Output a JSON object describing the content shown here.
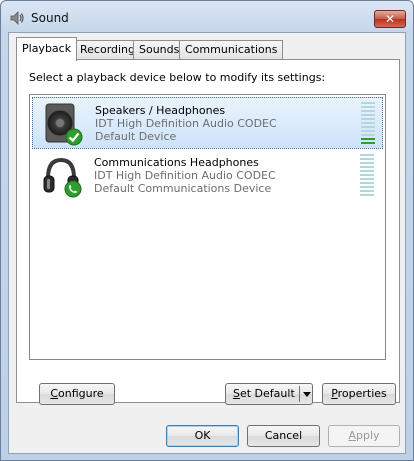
{
  "window": {
    "title": "Sound",
    "close_label": "✕"
  },
  "tabs": [
    {
      "label": "Playback"
    },
    {
      "label": "Recording"
    },
    {
      "label": "Sounds"
    },
    {
      "label": "Communications"
    }
  ],
  "instruction": "Select a playback device below to modify its settings:",
  "devices": [
    {
      "name": "Speakers / Headphones",
      "driver": "IDT High Definition Audio CODEC",
      "status": "Default Device",
      "icon": "speaker-icon",
      "badge": "default-check-icon",
      "meter_level": 0.1
    },
    {
      "name": "Communications Headphones",
      "driver": "IDT High Definition Audio CODEC",
      "status": "Default Communications Device",
      "icon": "headphones-icon",
      "badge": "communications-phone-icon",
      "meter_level": 0
    }
  ],
  "buttons": {
    "configure": {
      "prefix": "",
      "mnemonic": "C",
      "suffix": "onfigure"
    },
    "set_default": {
      "prefix": "",
      "mnemonic": "S",
      "suffix": "et Default"
    },
    "properties": {
      "prefix": "",
      "mnemonic": "P",
      "suffix": "roperties"
    },
    "ok": "OK",
    "cancel": "Cancel",
    "apply": {
      "prefix": "",
      "mnemonic": "A",
      "suffix": "pply"
    }
  },
  "colors": {
    "selection": "#cde3fa",
    "meter_lit": "#27a12d",
    "meter_off": "#b6d6dd",
    "check_badge": "#2e9e2e"
  }
}
